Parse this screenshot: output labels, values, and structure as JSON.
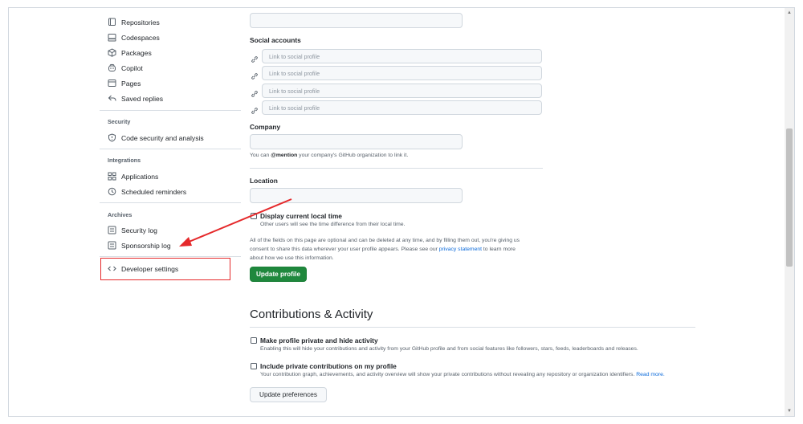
{
  "sidebar": {
    "items": [
      {
        "label": "Repositories",
        "icon": "repo-icon"
      },
      {
        "label": "Codespaces",
        "icon": "codespaces-icon"
      },
      {
        "label": "Packages",
        "icon": "package-icon"
      },
      {
        "label": "Copilot",
        "icon": "copilot-icon"
      },
      {
        "label": "Pages",
        "icon": "browser-icon"
      },
      {
        "label": "Saved replies",
        "icon": "reply-icon"
      }
    ],
    "security_heading": "Security",
    "security_items": [
      {
        "label": "Code security and analysis",
        "icon": "shield-icon"
      }
    ],
    "integrations_heading": "Integrations",
    "integrations_items": [
      {
        "label": "Applications",
        "icon": "apps-icon"
      },
      {
        "label": "Scheduled reminders",
        "icon": "clock-icon"
      }
    ],
    "archives_heading": "Archives",
    "archives_items": [
      {
        "label": "Security log",
        "icon": "log-icon"
      },
      {
        "label": "Sponsorship log",
        "icon": "log-icon"
      }
    ],
    "developer_settings": "Developer settings"
  },
  "form": {
    "social_accounts_label": "Social accounts",
    "social_placeholder": "Link to social profile",
    "company_label": "Company",
    "company_note_pre": "You can ",
    "company_note_mention": "@mention",
    "company_note_post": " your company's GitHub organization to link it.",
    "location_label": "Location",
    "local_time_label": "Display current local time",
    "local_time_note": "Other users will see the time difference from their local time.",
    "optional_note_1": "All of the fields on this page are optional and can be deleted at any time, and by filling them out, you're giving us",
    "optional_note_2_pre": "consent to share this data wherever your user profile appears. Please see our ",
    "optional_note_link": "privacy statement",
    "optional_note_2_post": " to learn more",
    "optional_note_3": "about how we use this information.",
    "update_profile_button": "Update profile"
  },
  "contributions": {
    "heading": "Contributions & Activity",
    "private_label": "Make profile private and hide activity",
    "private_note": "Enabling this will hide your contributions and activity from your GitHub profile and from social features like followers, stars, feeds, leaderboards and releases.",
    "include_private_label": "Include private contributions on my profile",
    "include_private_note": "Your contribution graph, achievements, and activity overview will show your private contributions without revealing any repository or organization identifiers.",
    "read_more": "Read more.",
    "update_preferences_button": "Update preferences"
  },
  "colors": {
    "primary_button": "#1f883d",
    "annotation_red": "#e5292b",
    "link_blue": "#0969da"
  }
}
